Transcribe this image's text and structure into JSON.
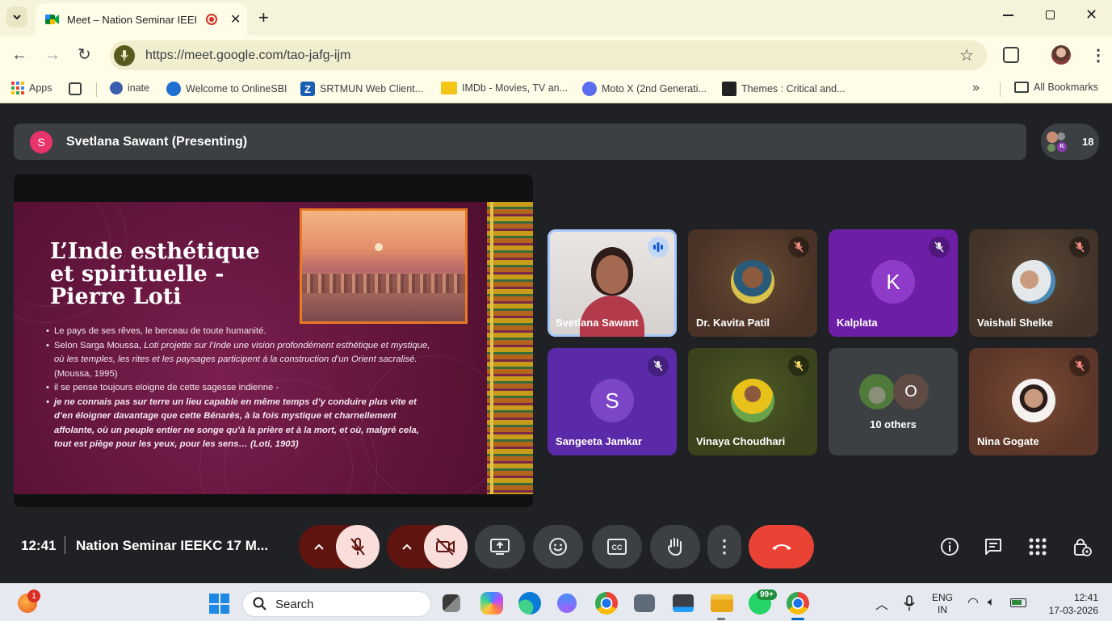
{
  "browser": {
    "tab_title": "Meet – Nation Seminar IEEKC",
    "url": "https://meet.google.com/tao-jafg-ijm",
    "bookmarks": [
      {
        "label": "Apps",
        "icon": "apps-grid-icon"
      },
      {
        "label": "inate",
        "icon": "inate-icon"
      },
      {
        "label": "Welcome to OnlineSBI",
        "icon": "sbi-icon"
      },
      {
        "label": "SRTMUN Web Client...",
        "icon": "zimbra-icon"
      },
      {
        "label": "IMDb - Movies, TV an...",
        "icon": "imdb-icon"
      },
      {
        "label": "Moto X (2nd Generati...",
        "icon": "moto-icon"
      },
      {
        "label": "Themes : Critical and...",
        "icon": "sfe-icon"
      }
    ],
    "all_bookmarks": "All Bookmarks"
  },
  "meet": {
    "presenter_initial": "S",
    "presenter_bar": "Svetlana Sawant (Presenting)",
    "participant_count": "18",
    "slide": {
      "title_line1": "L’Inde esthétique",
      "title_line2": "et spirituelle -",
      "title_line3": "Pierre Loti",
      "bullet1": "Le pays de ses rêves, le berceau de toute humanité.",
      "bullet2_pre": "Selon Sarga Moussa, ",
      "bullet2_italic": "Loti projette sur l’Inde une vision profondément esthétique et mystique, où les temples, les rites et les paysages participent à la construction d’un Orient sacralisé.",
      "bullet2_post": " (Moussa, 1995)",
      "bullet3": "il se pense toujours eloigne de cette sagesse indienne -",
      "bullet4": "je ne connais pas sur terre un lieu capable en même temps d’y conduire plus vite et d’en éloigner davantage que cette Bénarès, à la fois mystique et charnellement affolante, où un peuple entier ne songe qu’à la prière et à la mort, et où, malgré cela, tout est piège pour les yeux, pour les sens… (Loti, 1903)"
    },
    "tiles": [
      {
        "name": "Svetlana Sawant",
        "kind": "video"
      },
      {
        "name": "Dr. Kavita Patil",
        "kind": "photo"
      },
      {
        "name": "Kalplata",
        "initial": "K"
      },
      {
        "name": "Vaishali Shelke",
        "kind": "photo"
      },
      {
        "name": "Sangeeta Jamkar",
        "initial": "S"
      },
      {
        "name": "Vinaya Choudhari",
        "kind": "photo"
      },
      {
        "name": "10 others",
        "initial": "O"
      },
      {
        "name": "Nina Gogate",
        "kind": "photo"
      }
    ],
    "time": "12:41",
    "meeting_title": "Nation Seminar IEEKC 17 M..."
  },
  "taskbar": {
    "search_placeholder": "Search",
    "notification_badge": "1",
    "whatsapp_badge": "99+",
    "lang_top": "ENG",
    "lang_bottom": "IN",
    "clock_time": "12:41",
    "clock_date": "17-03-2026"
  },
  "colors": {
    "meet_bg": "#202124",
    "end_call": "#ea4335",
    "mic_off_bg": "#f9dedc",
    "chrome_bg": "#fffde8"
  }
}
